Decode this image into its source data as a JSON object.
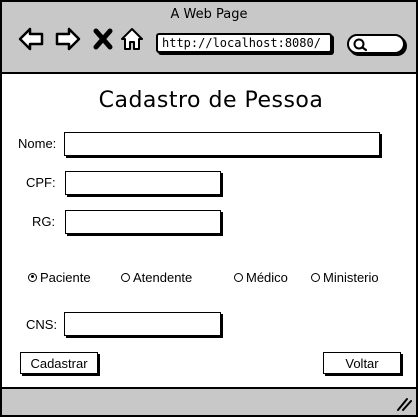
{
  "browser": {
    "window_title": "A Web Page",
    "url": "http://localhost:8080/",
    "icons": [
      "back-arrow-icon",
      "forward-arrow-icon",
      "close-icon",
      "home-icon",
      "search-icon",
      "resize-handle-icon"
    ]
  },
  "form": {
    "title": "Cadastro de Pessoa",
    "fields": {
      "nome": {
        "label": "Nome:",
        "value": ""
      },
      "cpf": {
        "label": "CPF:",
        "value": ""
      },
      "rg": {
        "label": "RG:",
        "value": ""
      },
      "cns": {
        "label": "CNS:",
        "value": ""
      }
    },
    "role_options": [
      {
        "label": "Paciente",
        "selected": true
      },
      {
        "label": "Atendente",
        "selected": false
      },
      {
        "label": "Médico",
        "selected": false
      },
      {
        "label": "Ministerio",
        "selected": false
      }
    ],
    "buttons": {
      "submit_label": "Cadastrar",
      "back_label": "Voltar"
    }
  }
}
